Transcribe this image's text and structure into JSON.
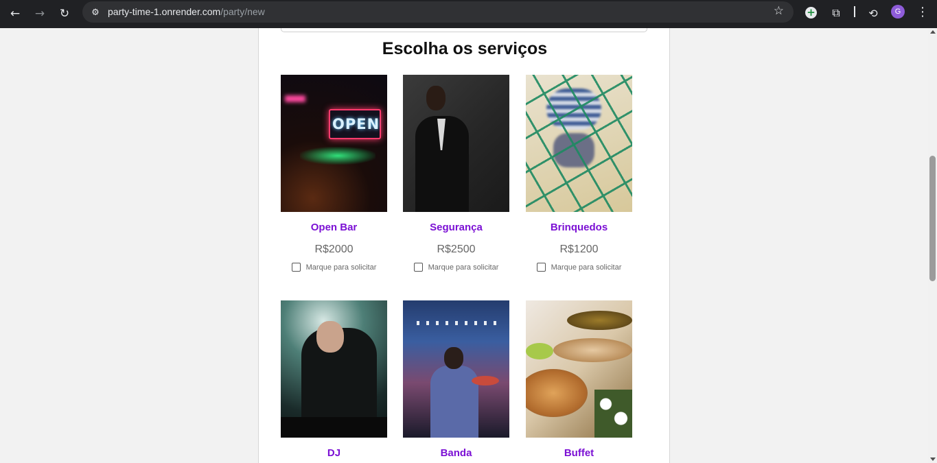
{
  "browser": {
    "back_icon": "←",
    "forward_icon": "→",
    "reload_icon": "↻",
    "site_info_icon": "⚙",
    "url_domain": "party-time-1.onrender.com",
    "url_path": "/party/new",
    "bookmark_icon": "☆",
    "extension_add_icon": "+",
    "extensions_icon": "⧉",
    "performance_icon": "⟲",
    "profile_initial": "G",
    "menu_icon": "⋮"
  },
  "page": {
    "section_title": "Escolha os serviços",
    "checkbox_label": "Marque para solicitar",
    "services": [
      {
        "name": "Open Bar",
        "price": "R$2000",
        "photo_text": "OPEN"
      },
      {
        "name": "Segurança",
        "price": "R$2500"
      },
      {
        "name": "Brinquedos",
        "price": "R$1200"
      },
      {
        "name": "DJ"
      },
      {
        "name": "Banda"
      },
      {
        "name": "Buffet"
      }
    ]
  },
  "colors": {
    "service_name": "#7b10d4",
    "price": "#666666",
    "chrome_bg": "#202124",
    "omnibox_bg": "#303134",
    "avatar_bg": "#8e5cd9"
  }
}
